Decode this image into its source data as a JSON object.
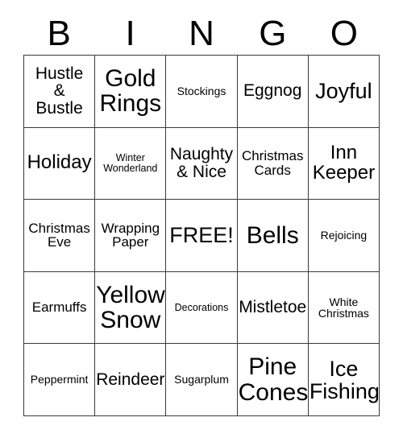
{
  "card": {
    "title_letters": [
      "B",
      "I",
      "N",
      "G",
      "O"
    ],
    "free_space_label": "FREE!",
    "colors": {
      "background": "#ffffff",
      "text": "#000000",
      "grid_line": "#3a3a3a"
    },
    "rows": [
      [
        {
          "label": "Hustle\n&\nBustle",
          "size": "fs-md"
        },
        {
          "label": "Gold\nRings",
          "size": "fs-xxl"
        },
        {
          "label": "Stockings",
          "size": "fs-xs"
        },
        {
          "label": "Eggnog",
          "size": "fs-md"
        },
        {
          "label": "Joyful",
          "size": "fs-xl"
        }
      ],
      [
        {
          "label": "Holiday",
          "size": "fs-lg"
        },
        {
          "label": "Winter\nWonderland",
          "size": "fs-xxs"
        },
        {
          "label": "Naughty\n& Nice",
          "size": "fs-md"
        },
        {
          "label": "Christmas\nCards",
          "size": "fs-sm"
        },
        {
          "label": "Inn\nKeeper",
          "size": "fs-lg"
        }
      ],
      [
        {
          "label": "Christmas\nEve",
          "size": "fs-sm"
        },
        {
          "label": "Wrapping\nPaper",
          "size": "fs-sm"
        },
        {
          "label": "FREE!",
          "size": "fs-xl"
        },
        {
          "label": "Bells",
          "size": "fs-xxl"
        },
        {
          "label": "Rejoicing",
          "size": "fs-xs"
        }
      ],
      [
        {
          "label": "Earmuffs",
          "size": "fs-sm"
        },
        {
          "label": "Yellow\nSnow",
          "size": "fs-xxl"
        },
        {
          "label": "Decorations",
          "size": "fs-xxs"
        },
        {
          "label": "Mistletoe",
          "size": "fs-md"
        },
        {
          "label": "White\nChristmas",
          "size": "fs-xs"
        }
      ],
      [
        {
          "label": "Peppermint",
          "size": "fs-xs"
        },
        {
          "label": "Reindeer",
          "size": "fs-md"
        },
        {
          "label": "Sugarplum",
          "size": "fs-xs"
        },
        {
          "label": "Pine\nCones",
          "size": "fs-xxl"
        },
        {
          "label": "Ice\nFishing",
          "size": "fs-xl"
        }
      ]
    ]
  }
}
